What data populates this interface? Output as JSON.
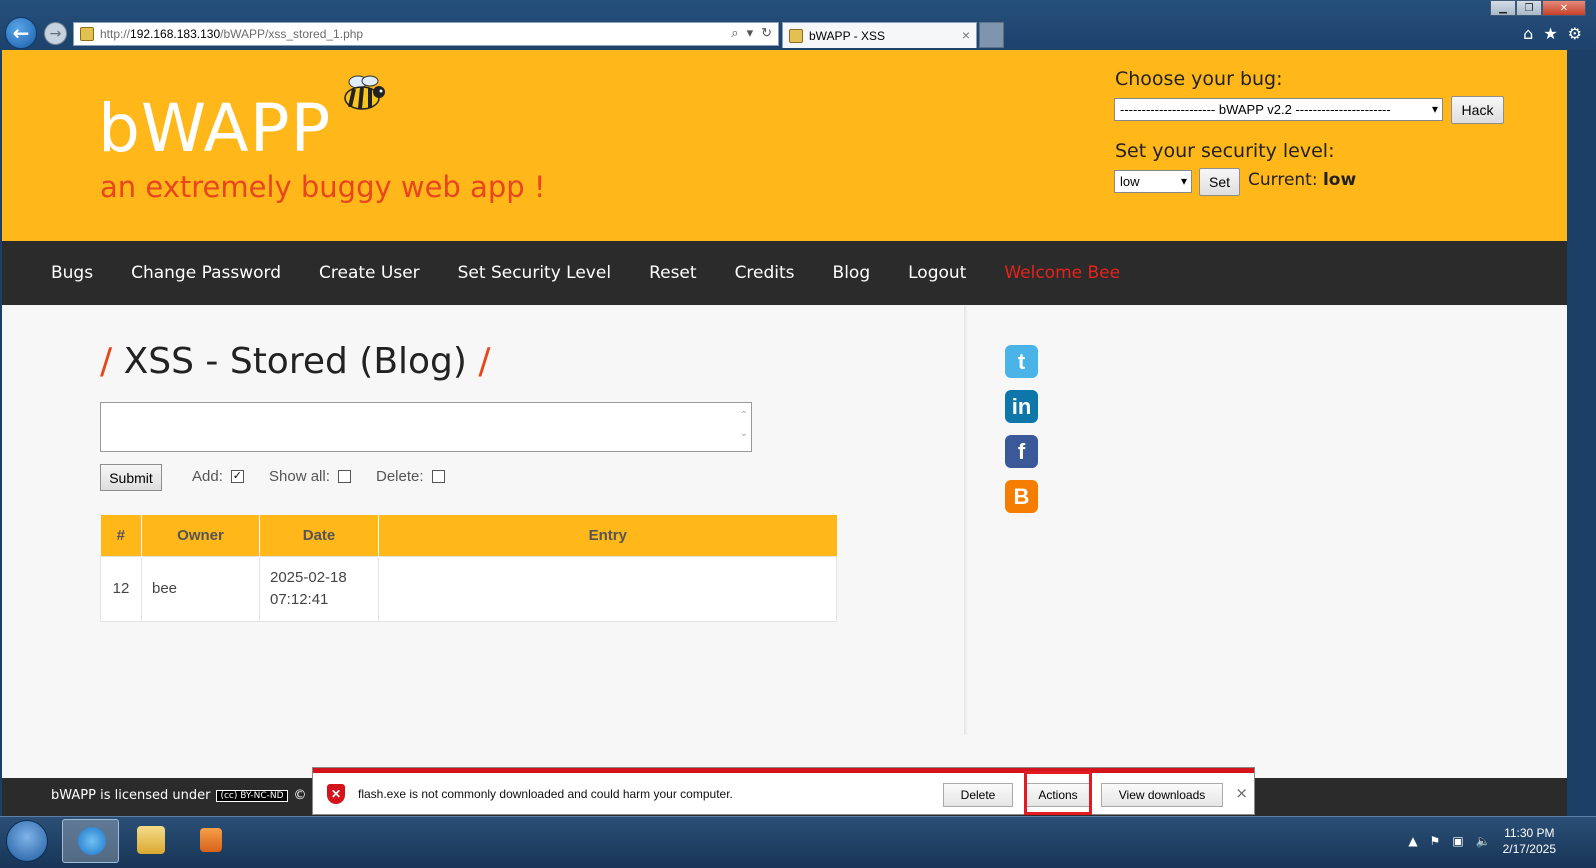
{
  "browser": {
    "url_scheme": "http://",
    "url_host": "192.168.183.130",
    "url_path": "/bWAPP/xss_stored_1.php",
    "tab_title": "bWAPP - XSS",
    "tab_close": "×"
  },
  "header": {
    "logo": "bWAPP",
    "tagline": "an extremely buggy web app !",
    "bug_label": "Choose your bug:",
    "bug_selected": "---------------------- bWAPP v2.2 ----------------------",
    "hack_label": "Hack",
    "level_label": "Set your security level:",
    "level_selected": "low",
    "set_label": "Set",
    "current_prefix": "Current:",
    "current_value": "low"
  },
  "menu": {
    "items": [
      "Bugs",
      "Change Password",
      "Create User",
      "Set Security Level",
      "Reset",
      "Credits",
      "Blog",
      "Logout"
    ],
    "welcome": "Welcome Bee"
  },
  "main": {
    "title_slash": "/",
    "title": "XSS - Stored (Blog)",
    "submit_label": "Submit",
    "add_label": "Add:",
    "add_checked": true,
    "showall_label": "Show all:",
    "showall_checked": false,
    "delete_label": "Delete:",
    "delete_checked": false,
    "table": {
      "headers": [
        "#",
        "Owner",
        "Date",
        "Entry"
      ],
      "rows": [
        {
          "id": "12",
          "owner": "bee",
          "date": "2025-02-18",
          "time": "07:12:41",
          "entry": ""
        }
      ]
    }
  },
  "social": [
    {
      "name": "twitter-icon",
      "glyph": "t",
      "color": "#4ab3e8"
    },
    {
      "name": "linkedin-icon",
      "glyph": "in",
      "color": "#0e76a8"
    },
    {
      "name": "facebook-icon",
      "glyph": "f",
      "color": "#3b5998"
    },
    {
      "name": "blogger-icon",
      "glyph": "B",
      "color": "#f57d00"
    }
  ],
  "footer": {
    "text": "bWAPP is licensed under",
    "badge": "(cc) BY-NC-ND",
    "copyright": "©"
  },
  "download_bar": {
    "message": "flash.exe is not commonly downloaded and could harm your computer.",
    "delete_label": "Delete",
    "actions_label": "Actions",
    "view_label": "View downloads",
    "close": "×"
  },
  "taskbar": {
    "time": "11:30 PM",
    "date": "2/17/2025"
  },
  "colors": {
    "header_bg": "#ffb71a",
    "menu_bg": "#2b2b2b",
    "accent_red": "#e8461e",
    "highlight_red": "#e21b23"
  }
}
